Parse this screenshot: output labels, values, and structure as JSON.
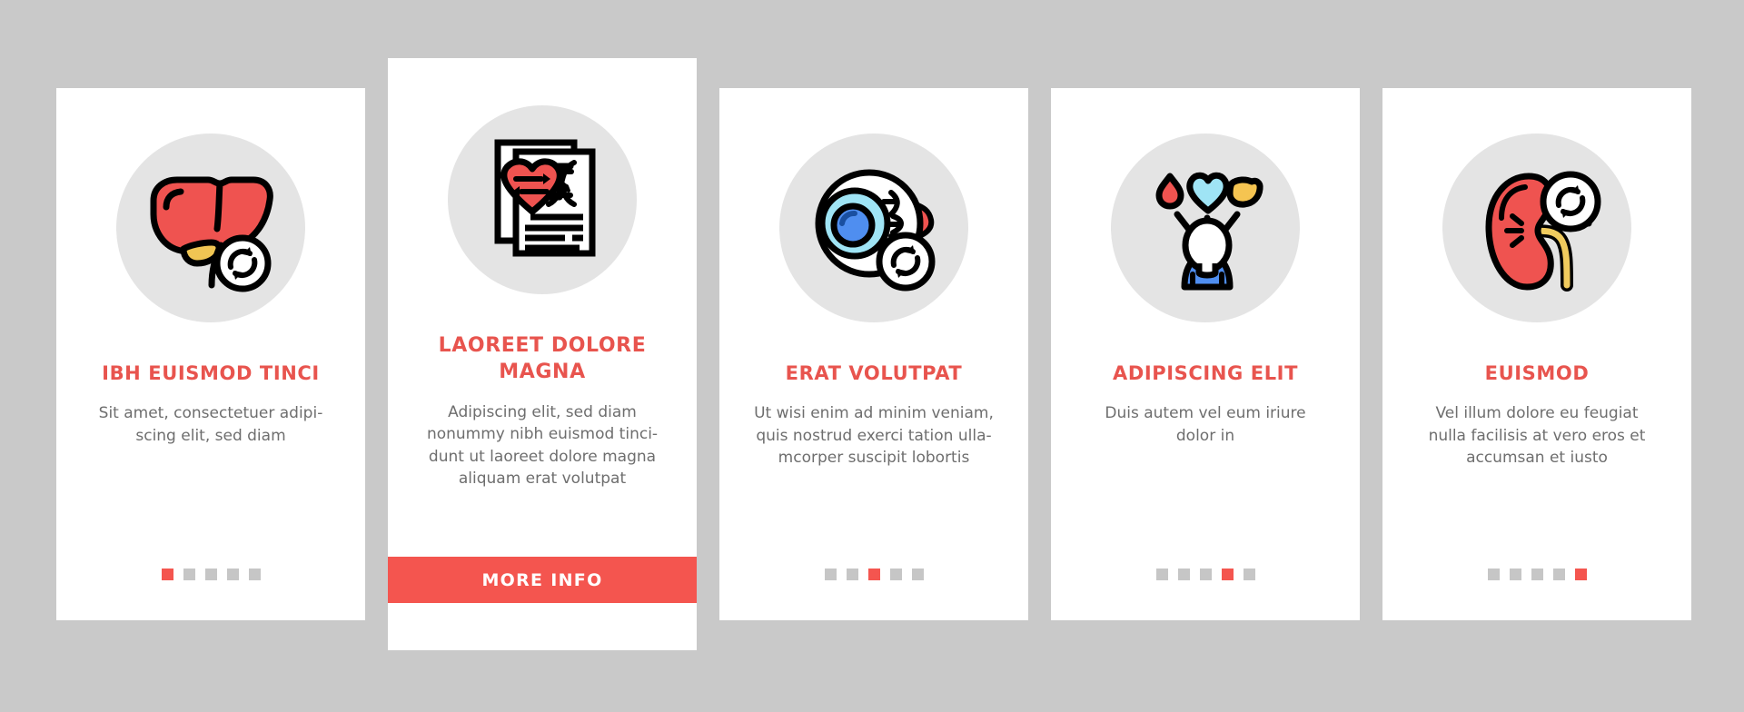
{
  "theme": {
    "background": "#c9c9c9",
    "card_background": "#ffffff",
    "accent": "#f4554f",
    "title_color": "#e8544e",
    "body_text_color": "#6e6e6e",
    "icon_circle": "#e4e4e4",
    "dot_inactive": "#c6c6c6"
  },
  "cards": [
    {
      "icon_name": "liver-transplant-icon",
      "title": "IBH EUISMOD TINCI",
      "description": "Sit amet, consectetuer adipi-\nscing elit, sed diam",
      "dots": {
        "count": 5,
        "active_index": 0
      },
      "featured": false,
      "button": null
    },
    {
      "icon_name": "heart-dna-document-icon",
      "title": "LAOREET DOLORE MAGNA",
      "description": "Adipiscing elit, sed diam\nnonummy nibh euismod tinci-\ndunt ut laoreet dolore magna\naliquam erat volutpat",
      "dots": null,
      "featured": true,
      "button": {
        "label": "MORE INFO"
      }
    },
    {
      "icon_name": "eye-cornea-transplant-icon",
      "title": "ERAT VOLUTPAT",
      "description": "Ut wisi enim ad minim veniam,\nquis nostrud exerci tation ulla-\nmcorper suscipit lobortis",
      "dots": {
        "count": 5,
        "active_index": 2
      },
      "featured": false,
      "button": null
    },
    {
      "icon_name": "organ-donor-person-icon",
      "title": "ADIPISCING ELIT",
      "description": "Duis autem vel eum iriure\ndolor in",
      "dots": {
        "count": 5,
        "active_index": 3
      },
      "featured": false,
      "button": null
    },
    {
      "icon_name": "kidney-transplant-icon",
      "title": "EUISMOD",
      "description": "Vel illum dolore eu feugiat\nnulla facilisis at vero eros et\naccumsan et iusto",
      "dots": {
        "count": 5,
        "active_index": 4
      },
      "featured": false,
      "button": null
    }
  ]
}
